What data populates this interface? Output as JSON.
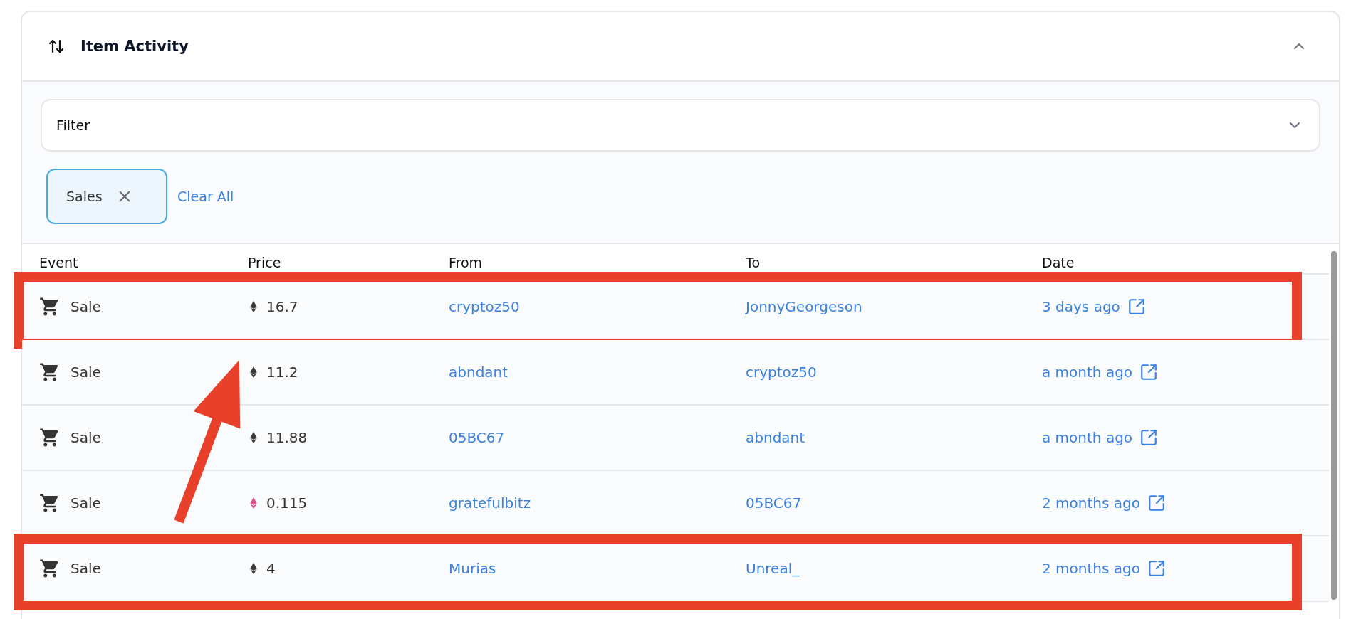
{
  "panel": {
    "title": "Item Activity",
    "expanded": true
  },
  "filter": {
    "placeholder": "Filter"
  },
  "active_filters": [
    {
      "label": "Sales"
    }
  ],
  "clear_all": "Clear All",
  "table": {
    "columns": [
      "Event",
      "Price",
      "From",
      "To",
      "Date"
    ],
    "rows": [
      {
        "event": "Sale",
        "price": "16.7",
        "color": "#3c3c3d",
        "from": "cryptoz50",
        "to": "JonnyGeorgeson",
        "date": "3 days ago",
        "highlighted": true
      },
      {
        "event": "Sale",
        "price": "11.2",
        "color": "#3c3c3d",
        "from": "abndant",
        "to": "cryptoz50",
        "date": "a month ago",
        "highlighted": false
      },
      {
        "event": "Sale",
        "price": "11.88",
        "color": "#3c3c3d",
        "from": "05BC67",
        "to": "abndant",
        "date": "a month ago",
        "highlighted": false
      },
      {
        "event": "Sale",
        "price": "0.115",
        "color": "#d9558a",
        "from": "gratefulbitz",
        "to": "05BC67",
        "date": "2 months ago",
        "highlighted": false
      },
      {
        "event": "Sale",
        "price": "4",
        "color": "#3c3c3d",
        "from": "Murias",
        "to": "Unreal_",
        "date": "2 months ago",
        "highlighted": true
      }
    ]
  }
}
